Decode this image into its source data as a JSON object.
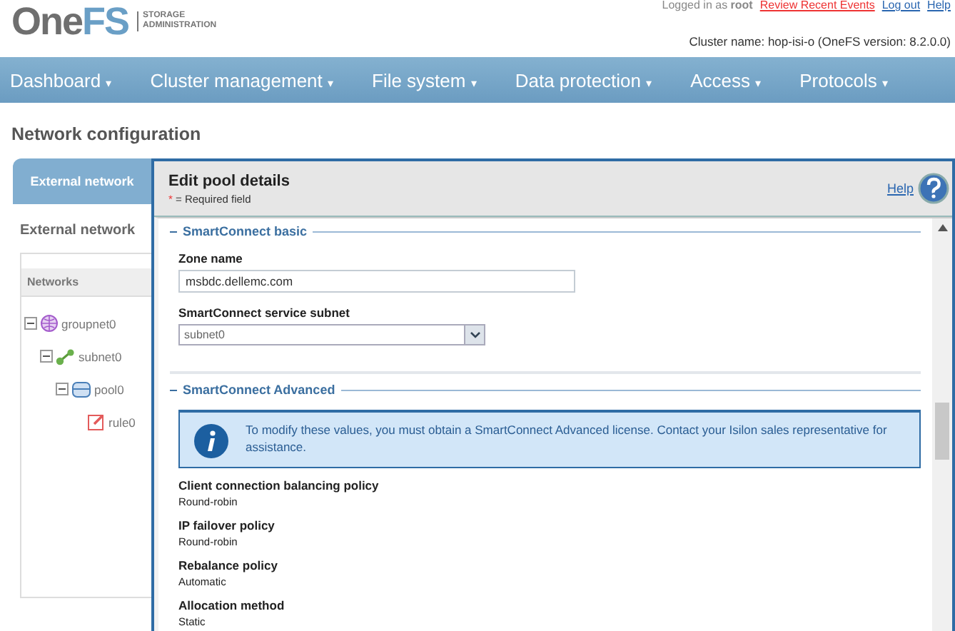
{
  "header": {
    "logo_main": "One",
    "logo_accent": "FS",
    "logo_sub_1": "STORAGE",
    "logo_sub_2": "ADMINISTRATION",
    "user_text": "Logged in as ",
    "user": "root",
    "links": [
      "Review Recent Events",
      "Log out",
      "Help"
    ],
    "cluster_info": "Cluster name: hop-isi-o (OneFS version: 8.2.0.0)"
  },
  "nav": [
    {
      "label": "Dashboard",
      "caret": "▾"
    },
    {
      "label": "Cluster management",
      "caret": "▾"
    },
    {
      "label": "File system",
      "caret": "▾"
    },
    {
      "label": "Data protection",
      "caret": "▾"
    },
    {
      "label": "Access",
      "caret": "▾"
    },
    {
      "label": "Protocols",
      "caret": "▾"
    }
  ],
  "page_title": "Network configuration",
  "tabs": [
    {
      "label": "External network",
      "selected": true
    }
  ],
  "sidebar": {
    "title": "External network",
    "column": "Networks",
    "tree": [
      {
        "label": "groupnet0",
        "kind": "groupnet",
        "expanded": true,
        "children": [
          {
            "label": "subnet0",
            "kind": "subnet",
            "expanded": true,
            "children": [
              {
                "label": "pool0",
                "kind": "pool",
                "expanded": true,
                "children": [
                  {
                    "label": "rule0",
                    "kind": "rule"
                  }
                ]
              }
            ]
          }
        ]
      }
    ]
  },
  "dialog": {
    "title": "Edit pool details",
    "required_mark": "*",
    "required_note": " = Required field",
    "help": "Help",
    "basic": {
      "legend": "SmartConnect basic",
      "zone_label": "Zone name",
      "zone_value": "msbdc.dellemc.com",
      "subnet_label": "SmartConnect service subnet",
      "subnet_value": "subnet0"
    },
    "advanced": {
      "legend": "SmartConnect Advanced",
      "info": "To modify these values, you must obtain a SmartConnect Advanced license. Contact your Isilon sales representative for assistance.",
      "fields": [
        {
          "label": "Client connection balancing policy",
          "value": "Round-robin"
        },
        {
          "label": "IP failover policy",
          "value": "Round-robin"
        },
        {
          "label": "Rebalance policy",
          "value": "Automatic"
        },
        {
          "label": "Allocation method",
          "value": "Static"
        }
      ]
    }
  }
}
